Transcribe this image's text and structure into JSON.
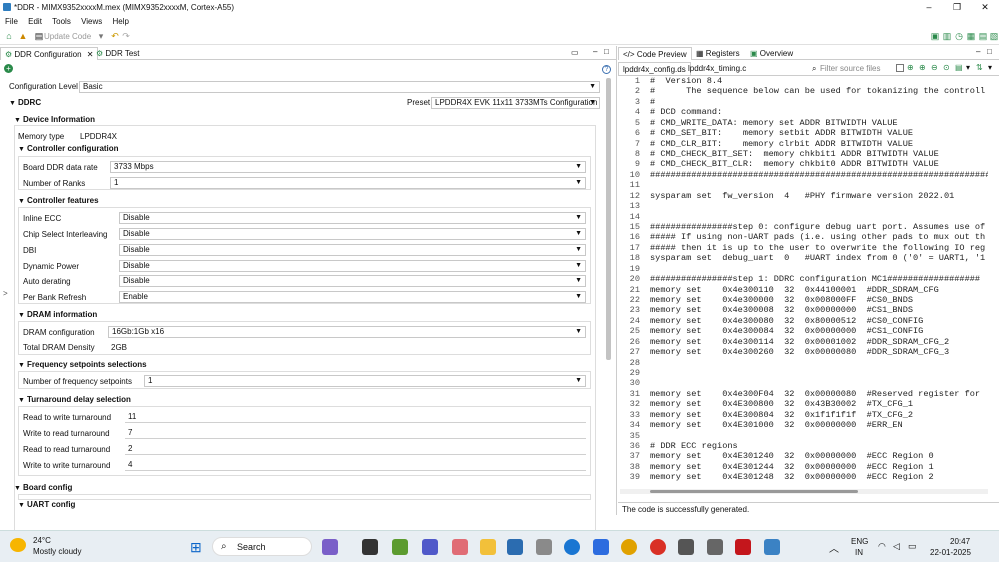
{
  "window": {
    "title": "*DDR - MIMX9352xxxxM.mex (MIMX9352xxxxM, Cortex-A55)"
  },
  "menu": [
    "File",
    "Edit",
    "Tools",
    "Views",
    "Help"
  ],
  "toolbar": {
    "update_code": "Update Code"
  },
  "left_tabs": [
    "DDR Configuration",
    "DDR Test"
  ],
  "config": {
    "level_label": "Configuration Level",
    "level_value": "Basic",
    "ddrc": "DDRC",
    "preset_label": "Preset",
    "preset_value": "LPDDR4X EVK 11x11 3733MTs Configuration",
    "device_info": "Device Information",
    "memory_type_label": "Memory type",
    "memory_type_value": "LPDDR4X",
    "controller_cfg": "Controller configuration",
    "board_rate_label": "Board DDR data rate",
    "board_rate_value": "3733 Mbps",
    "ranks_label": "Number of Ranks",
    "ranks_value": "1",
    "controller_features": "Controller features",
    "features": [
      {
        "label": "Inline ECC",
        "value": "Disable"
      },
      {
        "label": "Chip Select Interleaving",
        "value": "Disable"
      },
      {
        "label": "DBI",
        "value": "Disable"
      },
      {
        "label": "Dynamic Power",
        "value": "Disable"
      },
      {
        "label": "Auto derating",
        "value": "Disable"
      },
      {
        "label": "Per Bank Refresh",
        "value": "Enable"
      }
    ],
    "dram_info": "DRAM information",
    "dram_cfg_label": "DRAM configuration",
    "dram_cfg_value": "16Gb:1Gb x16",
    "density_label": "Total DRAM Density",
    "density_value": "2GB",
    "freq_sel": "Frequency setpoints selections",
    "num_freq_label": "Number of frequency setpoints",
    "num_freq_value": "1",
    "turnaround": "Turnaround delay selection",
    "turns": [
      {
        "label": "Read to write turnaround",
        "value": "11"
      },
      {
        "label": "Write to read turnaround",
        "value": "7"
      },
      {
        "label": "Read to read turnaround",
        "value": "2"
      },
      {
        "label": "Write to write turnaround",
        "value": "4"
      }
    ],
    "board_config": "Board config",
    "uart_config": "UART config"
  },
  "right_tabs": [
    "Code Preview",
    "Registers",
    "Overview"
  ],
  "file_tabs": [
    "lpddr4x_config.ds",
    "lpddr4x_timing.c"
  ],
  "filter_placeholder": "Filter source files",
  "code_lines": [
    "#  Version 8.4",
    "#      The sequence below can be used for tokanizing the controll",
    "#",
    "# DCD command:",
    "# CMD_WRITE_DATA: memory set ADDR BITWIDTH VALUE",
    "# CMD_SET_BIT:    memory setbit ADDR BITWIDTH VALUE",
    "# CMD_CLR_BIT:    memory clrbit ADDR BITWIDTH VALUE",
    "# CMD_CHECK_BIT_SET:  memory chkbit1 ADDR BITWIDTH VALUE",
    "# CMD_CHECK_BIT_CLR:  memory chkbit0 ADDR BITWIDTH VALUE",
    "##################################################################",
    "",
    "sysparam set  fw_version  4   #PHY firmware version 2022.01",
    "",
    "",
    "################step 0: configure debug uart port. Assumes use of",
    "##### If using non-UART pads (i.e. using other pads to mux out th",
    "##### then it is up to the user to overwrite the following IO reg",
    "sysparam set  debug_uart  0   #UART index from 0 ('0' = UART1, '1",
    "",
    "################step 1: DDRC configuration MC1##################",
    "memory set    0x4e300110  32  0x44100001  #DDR_SDRAM_CFG",
    "memory set    0x4e300000  32  0x008000FF  #CS0_BNDS",
    "memory set    0x4e300008  32  0x00000000  #CS1_BNDS",
    "memory set    0x4e300080  32  0x80000512  #CS0_CONFIG",
    "memory set    0x4e300084  32  0x00000000  #CS1_CONFIG",
    "memory set    0x4e300114  32  0x00001002  #DDR_SDRAM_CFG_2",
    "memory set    0x4e300260  32  0x00000080  #DDR_SDRAM_CFG_3",
    "",
    "",
    "",
    "memory set    0x4e300F04  32  0x00000080  #Reserved register for",
    "memory set    0x4E300800  32  0x43B30002  #TX_CFG_1",
    "memory set    0x4E300804  32  0x1f1f1f1f  #TX_CFG_2",
    "memory set    0x4E301000  32  0x00000000  #ERR_EN",
    "",
    "# DDR ECC regions",
    "memory set    0x4E301240  32  0x00000000  #ECC Region 0",
    "memory set    0x4E301244  32  0x00000000  #ECC Region 1",
    "memory set    0x4E301248  32  0x00000000  #ECC Region 2"
  ],
  "status": "The code is successfully generated.",
  "taskbar": {
    "temp": "24°C",
    "weather": "Mostly cloudy",
    "search": "Search",
    "lang1": "ENG",
    "lang2": "IN",
    "time": "20:47",
    "date": "22-01-2025"
  }
}
